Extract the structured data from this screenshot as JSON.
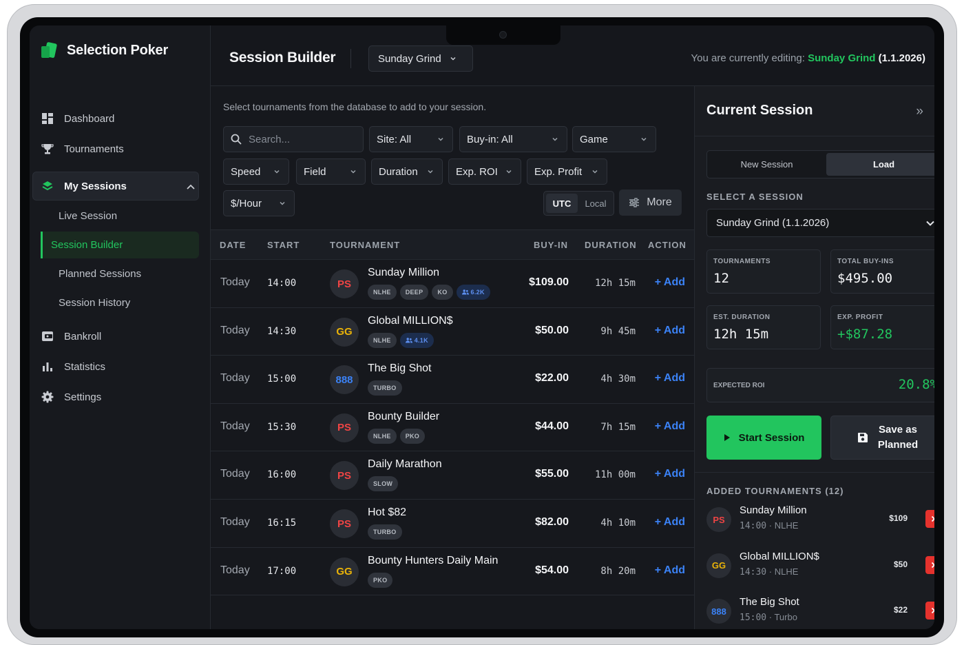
{
  "app": {
    "name": "Selection Poker"
  },
  "sidebar": {
    "items": [
      {
        "label": "Dashboard",
        "icon": "dashboard-icon"
      },
      {
        "label": "Tournaments",
        "icon": "trophy-icon"
      },
      {
        "label": "My Sessions",
        "icon": "layers-icon",
        "expanded": true
      },
      {
        "label": "Bankroll",
        "icon": "wallet-icon"
      },
      {
        "label": "Statistics",
        "icon": "bar-chart-icon"
      },
      {
        "label": "Settings",
        "icon": "gear-icon"
      }
    ],
    "sub_items": [
      "Live Session",
      "Session Builder",
      "Planned Sessions",
      "Session History"
    ],
    "active_sub": "Session Builder"
  },
  "header": {
    "title": "Session Builder",
    "session_select": "Sunday Grind",
    "editing_prefix": "You are currently editing:",
    "editing_name": "Sunday Grind",
    "editing_date": "(1.1.2026)"
  },
  "main": {
    "hint": "Select tournaments from the database to add to your session.",
    "search_placeholder": "Search...",
    "filters": [
      "Site: All",
      "Buy-in: All",
      "Game",
      "Speed",
      "Field",
      "Duration",
      "Exp. ROI",
      "Exp. Profit",
      "$/Hour"
    ],
    "timezone": {
      "options": [
        "UTC",
        "Local"
      ],
      "selected": "UTC"
    },
    "more_label": "More",
    "columns": [
      "DATE",
      "START",
      "TOURNAMENT",
      "BUY-IN",
      "DURATION",
      "ACTION"
    ],
    "rows": [
      {
        "date": "Today",
        "start": "14:00",
        "site": "PS",
        "name": "Sunday Million",
        "tags": [
          "NLHE",
          "DEEP",
          "KO"
        ],
        "field": "6.2K",
        "buyin": "$109.00",
        "duration": "12h 15m",
        "action": "+ Add"
      },
      {
        "date": "Today",
        "start": "14:30",
        "site": "GG",
        "name": "Global MILLION$",
        "tags": [
          "NLHE"
        ],
        "field": "4.1K",
        "buyin": "$50.00",
        "duration": "9h 45m",
        "action": "+ Add"
      },
      {
        "date": "Today",
        "start": "15:00",
        "site": "888",
        "name": "The Big Shot",
        "tags": [
          "TURBO"
        ],
        "field": "",
        "buyin": "$22.00",
        "duration": "4h 30m",
        "action": "+ Add"
      },
      {
        "date": "Today",
        "start": "15:30",
        "site": "PS",
        "name": "Bounty Builder",
        "tags": [
          "NLHE",
          "PKO"
        ],
        "field": "",
        "buyin": "$44.00",
        "duration": "7h 15m",
        "action": "+ Add"
      },
      {
        "date": "Today",
        "start": "16:00",
        "site": "PS",
        "name": "Daily Marathon",
        "tags": [
          "SLOW"
        ],
        "field": "",
        "buyin": "$55.00",
        "duration": "11h 00m",
        "action": "+ Add"
      },
      {
        "date": "Today",
        "start": "16:15",
        "site": "PS",
        "name": "Hot $82",
        "tags": [
          "TURBO"
        ],
        "field": "",
        "buyin": "$82.00",
        "duration": "4h 10m",
        "action": "+ Add"
      },
      {
        "date": "Today",
        "start": "17:00",
        "site": "GG",
        "name": "Bounty Hunters Daily Main",
        "tags": [
          "PKO"
        ],
        "field": "",
        "buyin": "$54.00",
        "duration": "8h 20m",
        "action": "+ Add"
      }
    ]
  },
  "panel": {
    "title": "Current Session",
    "collapse_glyph": "»",
    "tabs": [
      "New Session",
      "Load"
    ],
    "active_tab": "Load",
    "select_label": "SELECT A SESSION",
    "selected_session": "Sunday Grind (1.1.2026)",
    "stats": {
      "tournaments_label": "TOURNAMENTS",
      "tournaments": "12",
      "total_buyins_label": "TOTAL BUY-INS",
      "total_buyins": "$495.00",
      "duration_label": "EST. DURATION",
      "duration": "12h 15m",
      "profit_label": "EXP. PROFIT",
      "profit": "+$87.28",
      "roi_label": "EXPECTED ROI",
      "roi": "20.8%"
    },
    "start_label": "Start Session",
    "save_label_1": "Save as",
    "save_label_2": "Planned",
    "added_label": "ADDED TOURNAMENTS (12)",
    "added": [
      {
        "site": "PS",
        "name": "Sunday Million",
        "time": "14:00",
        "game": "NLHE",
        "price": "$109"
      },
      {
        "site": "GG",
        "name": "Global MILLION$",
        "time": "14:30",
        "game": "NLHE",
        "price": "$50"
      },
      {
        "site": "888",
        "name": "The Big Shot",
        "time": "15:00",
        "game": "Turbo",
        "price": "$22"
      }
    ]
  },
  "colors": {
    "accent": "#22c55e",
    "link": "#3b82f6",
    "danger": "#e5322d",
    "ps": "#ef4444",
    "gg": "#eab308",
    "888": "#3b82f6"
  }
}
